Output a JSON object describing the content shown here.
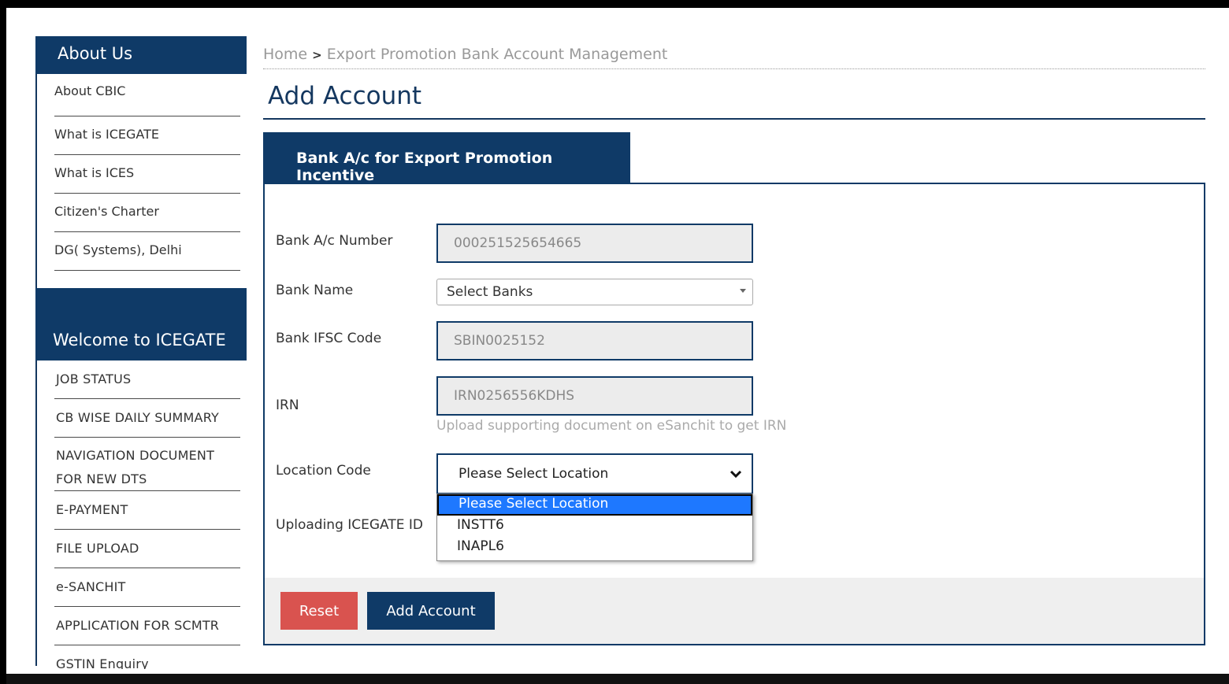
{
  "sidebar": {
    "about_title": "About Us",
    "about_items": [
      "About CBIC",
      "What is ICEGATE",
      "What is ICES",
      "Citizen's Charter",
      "DG( Systems), Delhi"
    ],
    "welcome_title": "Welcome to ICEGATE",
    "welcome_items": [
      "JOB STATUS",
      "CB WISE DAILY SUMMARY",
      "NAVIGATION DOCUMENT FOR NEW DTS",
      "E-PAYMENT",
      "FILE UPLOAD",
      "e-SANCHIT",
      "APPLICATION FOR SCMTR",
      "GSTIN Enquiry"
    ]
  },
  "breadcrumb": {
    "home": "Home",
    "separator": ">",
    "current": "Export Promotion Bank Account Management"
  },
  "page": {
    "title": "Add Account"
  },
  "tab": {
    "label": "Bank A/c for Export Promotion Incentive"
  },
  "form": {
    "bank_ac_number": {
      "label": "Bank A/c Number",
      "value": "000251525654665"
    },
    "bank_name": {
      "label": "Bank Name",
      "value": "Select Banks"
    },
    "ifsc": {
      "label": "Bank IFSC Code",
      "value": "SBIN0025152"
    },
    "irn": {
      "label": "IRN",
      "value": "IRN0256556KDHS",
      "hint": "Upload supporting document on eSanchit to get IRN"
    },
    "location": {
      "label": "Location Code",
      "value": "Please Select Location",
      "options": [
        "Please Select Location",
        "INSTT6",
        "INAPL6"
      ]
    },
    "uploading_id": {
      "label": "Uploading ICEGATE ID"
    }
  },
  "buttons": {
    "reset": "Reset",
    "add": "Add Account"
  },
  "colors": {
    "brand_navy": "#0f3a67",
    "reset_red": "#d9534f",
    "selected_option": "#1e78ff"
  }
}
